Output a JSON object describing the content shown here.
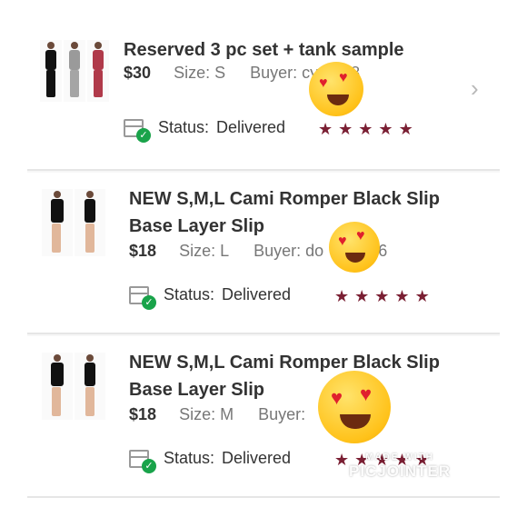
{
  "items": [
    {
      "title_lines": [
        "Reserved 3 pc set + tank sample"
      ],
      "price": "$30",
      "size": "Size: S",
      "buyer": "Buyer: cy",
      "buyer_tail": "8",
      "status_label": "Status:",
      "status_value": "Delivered",
      "rating": 5
    },
    {
      "title_lines": [
        "NEW S,M,L Cami Romper Black Slip",
        "Base Layer Slip"
      ],
      "price": "$18",
      "size": "Size: L",
      "buyer": "Buyer: do",
      "buyer_tail": "92916",
      "status_label": "Status:",
      "status_value": "Delivered",
      "rating": 5
    },
    {
      "title_lines": [
        "NEW S,M,L Cami Romper Black Slip",
        "Base Layer Slip"
      ],
      "price": "$18",
      "size": "Size: M",
      "buyer": "Buyer: ",
      "buyer_tail": "",
      "status_label": "Status:",
      "status_value": "Delivered",
      "rating": 5
    }
  ],
  "watermark": {
    "line1": "MADE WITH",
    "line2": "PICJOINTER"
  },
  "colors": {
    "star": "#7a1f33",
    "check": "#19a34a"
  },
  "icons": {
    "chevron": "chevron-right-icon",
    "box": "package-delivered-icon",
    "star": "star-icon",
    "emoji": "heart-eyes-emoji"
  }
}
